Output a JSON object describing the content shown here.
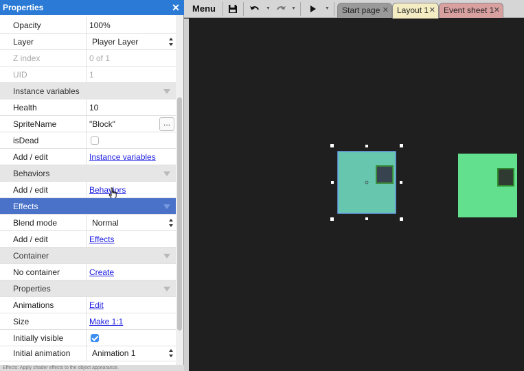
{
  "properties_panel": {
    "title": "Properties",
    "close_glyph": "✕",
    "status_text": "Effects: Apply shader effects to the object appearance.",
    "rows": [
      {
        "key": "Opacity",
        "value": "100%"
      },
      {
        "key": "Layer",
        "value": "Player Layer",
        "control": "select"
      },
      {
        "key": "Z index",
        "value": "0 of 1",
        "dim": true
      },
      {
        "key": "UID",
        "value": "1",
        "dim": true
      }
    ],
    "groups": {
      "instance_variables": "Instance variables",
      "behaviors": "Behaviors",
      "effects": "Effects",
      "container": "Container",
      "properties": "Properties"
    },
    "instance_vars": {
      "health_key": "Health",
      "health_value": "10",
      "spritename_key": "SpriteName",
      "spritename_value": "\"Block\"",
      "dots_label": "...",
      "isdead_key": "isDead",
      "add_edit_key": "Add / edit",
      "add_edit_link": "Instance variables"
    },
    "behaviors": {
      "add_edit_key": "Add / edit",
      "link": "Behaviors"
    },
    "effects": {
      "blend_key": "Blend mode",
      "blend_value": "Normal",
      "add_edit_key": "Add / edit",
      "link": "Effects"
    },
    "container": {
      "key": "No container",
      "link": "Create"
    },
    "props": {
      "animations_key": "Animations",
      "animations_link": "Edit",
      "size_key": "Size",
      "size_link": "Make 1:1",
      "visible_key": "Initially visible",
      "initial_anim_key": "Initial animation",
      "initial_anim_value": "Animation 1"
    }
  },
  "toolbar": {
    "menu_label": "Menu",
    "tabs": [
      {
        "label": "Start page",
        "color": "#9a9a9a"
      },
      {
        "label": "Layout 1",
        "color": "#f4ecc2"
      },
      {
        "label": "Event sheet 1",
        "color": "#d9a0a0"
      }
    ],
    "tab_close": "✕"
  },
  "colors": {
    "accent": "#2b7bd6",
    "selected_group": "#4a72c9",
    "sprite_selected": "#66c6ae",
    "sprite_other": "#62e08e",
    "sprite_inner": "#37434f"
  }
}
